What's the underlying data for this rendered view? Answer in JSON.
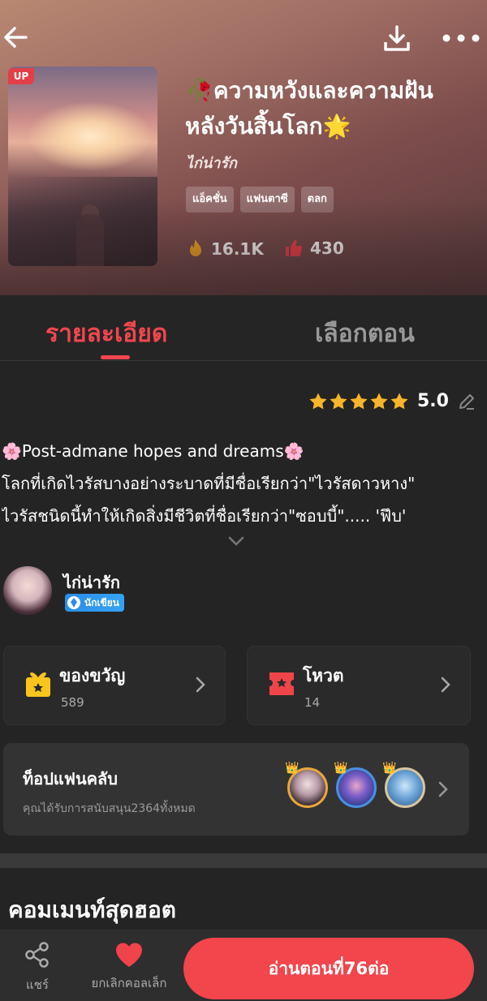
{
  "header": {
    "back_icon": "arrow-left-icon",
    "download_icon": "download-icon",
    "more_icon": "more-dots-icon"
  },
  "book": {
    "badge": "UP",
    "title": "🥀ความหวังและความฝันหลังวันสิ้นโลก🌟",
    "author": "ไก่น่ารัก",
    "tags": [
      "แอ็คชั่น",
      "แฟนตาซี",
      "ตลก"
    ],
    "views": "16.1K",
    "likes": "430"
  },
  "tabs": {
    "detail": "รายละเอียด",
    "episodes": "เลือกตอน"
  },
  "rating": {
    "value": "5.0",
    "stars": 5
  },
  "description": {
    "line1": "🌸Post-admane hopes and dreams🌸",
    "line2": "โลกที่เกิดไวรัสบางอย่างระบาดที่มีชื่อเรียกว่า\"ไวรัสดาวหาง\"",
    "line3": "ไวรัสชนิดนี้ทำให้เกิดสิ่งมีชีวิตที่ชื่อเรียกว่า\"ซอบบี้\"..... 'ฟึบ'"
  },
  "writer": {
    "name": "ไก่น่ารัก",
    "badge": "นักเขียน"
  },
  "gift": {
    "label": "ของขวัญ",
    "count": "589"
  },
  "vote": {
    "label": "โหวต",
    "count": "14"
  },
  "fanclub": {
    "title": "ท็อปแฟนคลับ",
    "subtitle": "คุณได้รับการสนับสนุน2364ทั้งหมด"
  },
  "comments": {
    "title": "คอมเมนท์สุดฮอต"
  },
  "bottom": {
    "share": "แชร์",
    "uncollect": "ยกเลิกคอลเล็ก",
    "read": "อ่านตอนที่76ต่อ"
  },
  "colors": {
    "accent": "#f2454c",
    "star": "#f6b52a",
    "gift": "#f7c51e"
  }
}
